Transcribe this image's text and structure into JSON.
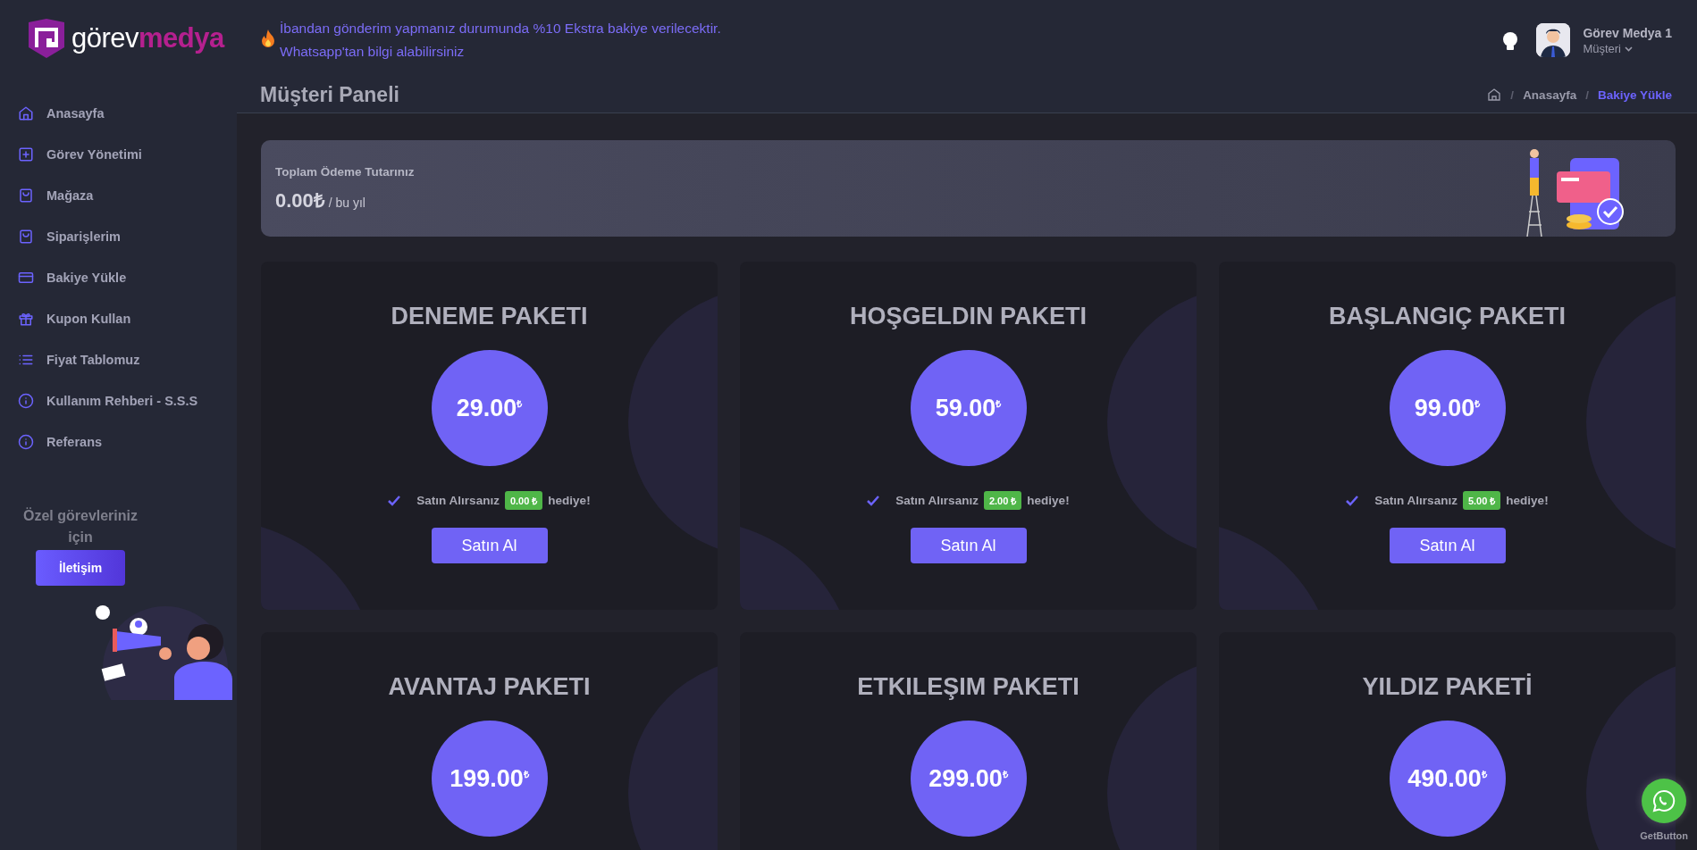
{
  "logo": {
    "first": "görev",
    "second": "medya"
  },
  "sidebar": {
    "items": [
      {
        "label": "Anasayfa"
      },
      {
        "label": "Görev Yönetimi"
      },
      {
        "label": "Mağaza"
      },
      {
        "label": "Siparişlerim"
      },
      {
        "label": "Bakiye Yükle"
      },
      {
        "label": "Kupon Kullan"
      },
      {
        "label": "Fiyat Tablomuz"
      },
      {
        "label": "Kullanım Rehberi - S.S.S"
      },
      {
        "label": "Referans"
      }
    ],
    "promo": {
      "text": "Özel görevleriniz için",
      "button": "İletişim"
    }
  },
  "announcement": {
    "lines": [
      "İbandan gönderim yapmanız durumunda %10 Ekstra bakiye verilecektir.",
      "Whatsapp'tan bilgi alabilirsiniz"
    ]
  },
  "user": {
    "name": "Görev Medya 1",
    "role": "Müşteri"
  },
  "page_title": "Müşteri Paneli",
  "breadcrumb": [
    {
      "separator": "/",
      "label": "Anasayfa",
      "current": false
    },
    {
      "separator": "/",
      "label": "Bakiye Yükle",
      "current": true
    }
  ],
  "summary": {
    "label": "Toplam Ödeme Tutarınız",
    "amount": "0.00₺",
    "period": "/ bu yıl"
  },
  "packages": [
    {
      "title": "DENEME PAKETI",
      "price": "29.00",
      "currency": "₺",
      "gift_prefix": "Satın Alırsanız",
      "gift": "0.00 ₺",
      "gift_suffix": "hediye!",
      "button": "Satın Al"
    },
    {
      "title": "HOŞGELDIN PAKETI",
      "price": "59.00",
      "currency": "₺",
      "gift_prefix": "Satın Alırsanız",
      "gift": "2.00 ₺",
      "gift_suffix": "hediye!",
      "button": "Satın Al"
    },
    {
      "title": "BAŞLANGIÇ PAKETI",
      "price": "99.00",
      "currency": "₺",
      "gift_prefix": "Satın Alırsanız",
      "gift": "5.00 ₺",
      "gift_suffix": "hediye!",
      "button": "Satın Al"
    },
    {
      "title": "AVANTAJ PAKETI",
      "price": "199.00",
      "currency": "₺"
    },
    {
      "title": "ETKILEŞIM PAKETI",
      "price": "299.00",
      "currency": "₺"
    },
    {
      "title": "YILDIZ PAKETİ",
      "price": "490.00",
      "currency": "₺"
    }
  ],
  "chat_widget": {
    "label": "GetButton"
  }
}
